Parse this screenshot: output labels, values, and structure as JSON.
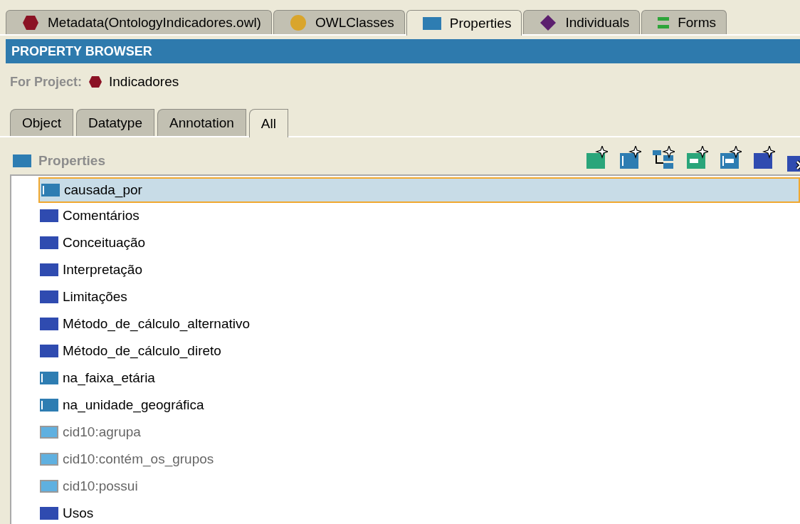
{
  "top_tabs": [
    {
      "label": "Metadata(OntologyIndicadores.owl)",
      "kind": "hexagon",
      "selected": false
    },
    {
      "label": "OWLClasses",
      "kind": "circle",
      "selected": false
    },
    {
      "label": "Properties",
      "kind": "rect",
      "selected": true
    },
    {
      "label": "Individuals",
      "kind": "diamond",
      "selected": false
    },
    {
      "label": "Forms",
      "kind": "bars",
      "selected": false
    }
  ],
  "header": {
    "title": "PROPERTY BROWSER"
  },
  "project": {
    "label": "For Project:",
    "name": "Indicadores"
  },
  "sub_tabs": [
    {
      "label": "Object",
      "selected": false
    },
    {
      "label": "Datatype",
      "selected": false
    },
    {
      "label": "Annotation",
      "selected": false
    },
    {
      "label": "All",
      "selected": true
    }
  ],
  "panel": {
    "title": "Properties"
  },
  "tree": [
    {
      "label": "causada_por",
      "kind": "object",
      "selected": true
    },
    {
      "label": "Comentários",
      "kind": "annotation",
      "selected": false
    },
    {
      "label": "Conceituação",
      "kind": "annotation",
      "selected": false
    },
    {
      "label": "Interpretação",
      "kind": "annotation",
      "selected": false
    },
    {
      "label": "Limitações",
      "kind": "annotation",
      "selected": false
    },
    {
      "label": "Método_de_cálculo_alternativo",
      "kind": "annotation",
      "selected": false
    },
    {
      "label": "Método_de_cálculo_direto",
      "kind": "annotation",
      "selected": false
    },
    {
      "label": "na_faixa_etária",
      "kind": "object",
      "selected": false
    },
    {
      "label": "na_unidade_geográfica",
      "kind": "object",
      "selected": false
    },
    {
      "label": "cid10:agrupa",
      "kind": "imported",
      "selected": false
    },
    {
      "label": "cid10:contém_os_grupos",
      "kind": "imported",
      "selected": false
    },
    {
      "label": "cid10:possui",
      "kind": "imported",
      "selected": false
    },
    {
      "label": "Usos",
      "kind": "annotation",
      "selected": false
    }
  ]
}
